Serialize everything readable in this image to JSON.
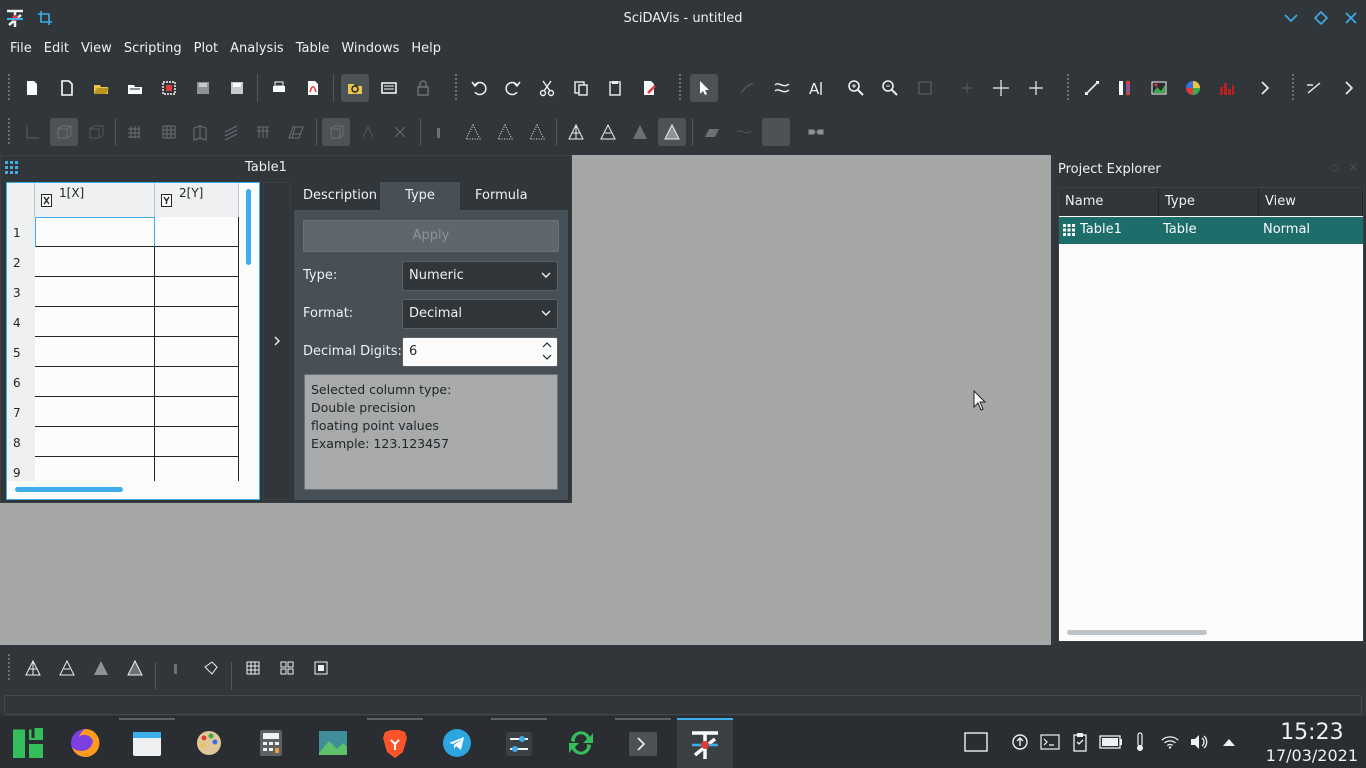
{
  "window": {
    "title": "SciDAVis - untitled"
  },
  "menu": [
    "File",
    "Edit",
    "View",
    "Scripting",
    "Plot",
    "Analysis",
    "Table",
    "Windows",
    "Help"
  ],
  "table_window": {
    "title": "Table1",
    "columns": [
      "1[X]",
      "2[Y]"
    ],
    "rows": [
      "1",
      "2",
      "3",
      "4",
      "5",
      "6",
      "7",
      "8",
      "9"
    ]
  },
  "tabs": {
    "description": "Description",
    "type": "Type",
    "formula": "Formula"
  },
  "type_panel": {
    "apply": "Apply",
    "type_label": "Type:",
    "type_value": "Numeric",
    "format_label": "Format:",
    "format_value": "Decimal",
    "digits_label": "Decimal Digits:",
    "digits_value": "6",
    "desc_lines": [
      "Selected column type:",
      "Double precision",
      "floating point values",
      "Example: 123.123457"
    ]
  },
  "project_explorer": {
    "title": "Project Explorer",
    "headers": [
      "Name",
      "Type",
      "View"
    ],
    "row": {
      "name": "Table1",
      "type": "Table",
      "view": "Normal"
    }
  },
  "clock": {
    "time": "15:23",
    "date": "17/03/2021"
  },
  "colors": {
    "accent": "#3daee9",
    "bg": "#31363b",
    "mdi": "#a5a6a6",
    "selection": "#1d6d6b"
  }
}
